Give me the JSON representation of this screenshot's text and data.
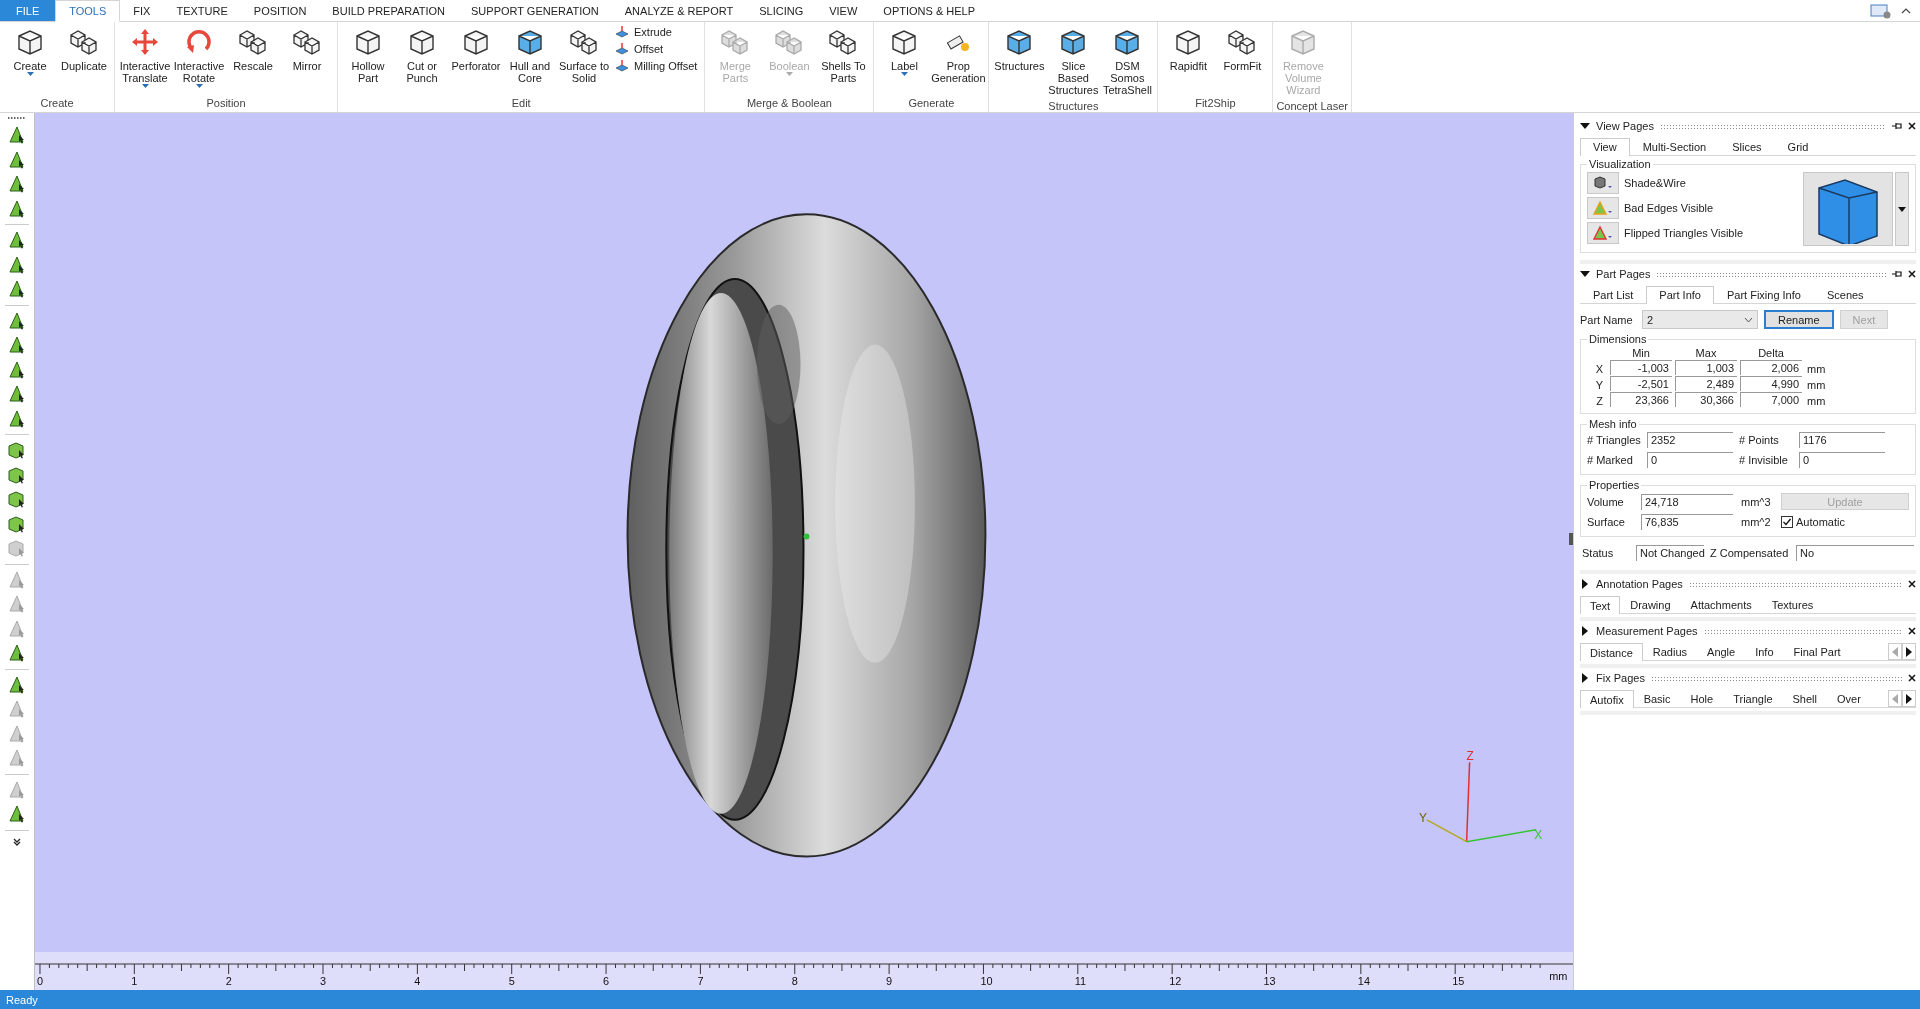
{
  "menu_tabs": [
    {
      "label": "FILE",
      "kind": "file",
      "selected": false
    },
    {
      "label": "TOOLS",
      "kind": "tab",
      "selected": true
    },
    {
      "label": "FIX",
      "kind": "tab",
      "selected": false
    },
    {
      "label": "TEXTURE",
      "kind": "tab",
      "selected": false
    },
    {
      "label": "POSITION",
      "kind": "tab",
      "selected": false
    },
    {
      "label": "BUILD PREPARATION",
      "kind": "tab",
      "selected": false
    },
    {
      "label": "SUPPORT GENERATION",
      "kind": "tab",
      "selected": false
    },
    {
      "label": "ANALYZE & REPORT",
      "kind": "tab",
      "selected": false
    },
    {
      "label": "SLICING",
      "kind": "tab",
      "selected": false
    },
    {
      "label": "VIEW",
      "kind": "tab",
      "selected": false
    },
    {
      "label": "OPTIONS & HELP",
      "kind": "tab",
      "selected": false
    }
  ],
  "ribbon_groups": [
    {
      "label": "Create",
      "buttons": [
        {
          "label": "Create",
          "kind": "cube",
          "dropdown": true,
          "disabled": false
        },
        {
          "label": "Duplicate",
          "kind": "cubes",
          "dropdown": false,
          "disabled": false
        }
      ]
    },
    {
      "label": "Position",
      "buttons": [
        {
          "label": "Interactive Translate",
          "kind": "move",
          "dropdown": true,
          "disabled": false
        },
        {
          "label": "Interactive Rotate",
          "kind": "rotate",
          "dropdown": true,
          "disabled": false
        },
        {
          "label": "Rescale",
          "kind": "cubes",
          "dropdown": false,
          "disabled": false
        },
        {
          "label": "Mirror",
          "kind": "cubes",
          "dropdown": false,
          "disabled": false
        }
      ]
    },
    {
      "label": "Edit",
      "buttons": [
        {
          "label": "Hollow Part",
          "kind": "cube",
          "dropdown": false,
          "disabled": false
        },
        {
          "label": "Cut or Punch",
          "kind": "cube",
          "dropdown": false,
          "disabled": false
        },
        {
          "label": "Perforator",
          "kind": "cube",
          "dropdown": false,
          "disabled": false
        },
        {
          "label": "Hull and Core",
          "kind": "bluecube",
          "dropdown": false,
          "disabled": false
        },
        {
          "label": "Surface to Solid",
          "kind": "cubes",
          "dropdown": false,
          "disabled": false
        },
        {
          "label": "Extrude",
          "kind": "small",
          "disabled": false
        },
        {
          "label": "Offset",
          "kind": "small",
          "disabled": false
        },
        {
          "label": "Milling Offset",
          "kind": "small",
          "disabled": false
        }
      ]
    },
    {
      "label": "Merge & Boolean",
      "buttons": [
        {
          "label": "Merge Parts",
          "kind": "cubes",
          "dropdown": false,
          "disabled": true
        },
        {
          "label": "Boolean",
          "kind": "cubes",
          "dropdown": true,
          "disabled": true
        },
        {
          "label": "Shells To Parts",
          "kind": "cubes",
          "dropdown": false,
          "disabled": false
        }
      ]
    },
    {
      "label": "Generate",
      "buttons": [
        {
          "label": "Label",
          "kind": "cube",
          "dropdown": true,
          "disabled": false
        },
        {
          "label": "Prop Generation",
          "kind": "prop",
          "dropdown": false,
          "disabled": false
        }
      ]
    },
    {
      "label": "Structures",
      "buttons": [
        {
          "label": "Structures",
          "kind": "bluecube",
          "dropdown": false,
          "disabled": false
        },
        {
          "label": "Slice Based Structures",
          "kind": "bluecube",
          "dropdown": false,
          "disabled": false
        },
        {
          "label": "DSM Somos TetraShell",
          "kind": "bluecube",
          "dropdown": false,
          "disabled": false
        }
      ]
    },
    {
      "label": "Fit2Ship",
      "buttons": [
        {
          "label": "Rapidfit",
          "kind": "cube",
          "dropdown": false,
          "disabled": false
        },
        {
          "label": "FormFit",
          "kind": "cubes",
          "dropdown": false,
          "disabled": false
        }
      ]
    },
    {
      "label": "Concept Laser",
      "buttons": [
        {
          "label": "Remove Volume Wizard",
          "kind": "cube",
          "dropdown": false,
          "disabled": true
        }
      ]
    }
  ],
  "left_toolbar": [
    [
      {
        "disabled": false
      },
      {
        "disabled": false
      },
      {
        "disabled": false
      },
      {
        "disabled": false
      }
    ],
    [
      {
        "disabled": false
      },
      {
        "disabled": false
      },
      {
        "disabled": false
      }
    ],
    [
      {
        "disabled": false
      },
      {
        "disabled": false
      },
      {
        "disabled": false
      },
      {
        "disabled": false
      },
      {
        "disabled": false
      }
    ],
    [
      {
        "disabled": false
      },
      {
        "disabled": false
      },
      {
        "disabled": false
      },
      {
        "disabled": false
      },
      {
        "disabled": true
      }
    ],
    [
      {
        "disabled": true
      },
      {
        "disabled": true
      },
      {
        "disabled": true
      },
      {
        "disabled": false
      }
    ],
    [
      {
        "disabled": false
      },
      {
        "disabled": true
      },
      {
        "disabled": true
      },
      {
        "disabled": true
      }
    ],
    [
      {
        "disabled": true
      },
      {
        "disabled": false
      }
    ]
  ],
  "viewport": {
    "axes": [
      "X",
      "Y",
      "Z"
    ]
  },
  "ruler": {
    "labels": [
      "0",
      "1",
      "2",
      "3",
      "4",
      "5",
      "6",
      "7",
      "8",
      "9",
      "10",
      "11",
      "12",
      "13",
      "14",
      "15"
    ],
    "unit": "mm"
  },
  "view_pages": {
    "title": "View Pages",
    "expanded": true,
    "tabs": [
      {
        "label": "View",
        "selected": true
      },
      {
        "label": "Multi-Section",
        "selected": false
      },
      {
        "label": "Slices",
        "selected": false
      },
      {
        "label": "Grid",
        "selected": false
      }
    ],
    "group": "Visualization",
    "options": [
      {
        "label": "Shade&Wire"
      },
      {
        "label": "Bad Edges Visible"
      },
      {
        "label": "Flipped Triangles Visible"
      }
    ]
  },
  "part_pages": {
    "title": "Part Pages",
    "expanded": true,
    "tabs": [
      {
        "label": "Part List",
        "selected": false
      },
      {
        "label": "Part Info",
        "selected": true
      },
      {
        "label": "Part Fixing Info",
        "selected": false
      },
      {
        "label": "Scenes",
        "selected": false
      }
    ],
    "part_name_label": "Part Name",
    "part_name": "2",
    "rename": "Rename",
    "next": {
      "label": "Next",
      "disabled": true
    },
    "dimensions": {
      "title": "Dimensions",
      "columns": [
        "Min",
        "Max",
        "Delta"
      ],
      "rows": [
        {
          "axis": "X",
          "values": [
            "-1,003",
            "1,003",
            "2,006"
          ],
          "unit": "mm"
        },
        {
          "axis": "Y",
          "values": [
            "-2,501",
            "2,489",
            "4,990"
          ],
          "unit": "mm"
        },
        {
          "axis": "Z",
          "values": [
            "23,366",
            "30,366",
            "7,000"
          ],
          "unit": "mm"
        }
      ]
    },
    "mesh_info": {
      "title": "Mesh info",
      "fields": [
        {
          "label": "# Triangles",
          "value": "2352"
        },
        {
          "label": "# Points",
          "value": "1176"
        },
        {
          "label": "# Marked",
          "value": "0"
        },
        {
          "label": "# Invisible",
          "value": "0"
        }
      ]
    },
    "properties": {
      "title": "Properties",
      "volume_label": "Volume",
      "volume": "24,718",
      "volume_unit": "mm^3",
      "surface_label": "Surface",
      "surface": "76,835",
      "surface_unit": "mm^2",
      "update": {
        "label": "Update",
        "disabled": true
      },
      "automatic": {
        "label": "Automatic",
        "checked": true
      }
    },
    "status_label": "Status",
    "status": "Not Changed",
    "z_comp_label": "Z Compensated",
    "z_comp": "No"
  },
  "collapsed_pages": [
    {
      "title": "Annotation Pages",
      "expanded": false,
      "scroll": false,
      "tabs": [
        {
          "label": "Text",
          "selected": true
        },
        {
          "label": "Drawing",
          "selected": false
        },
        {
          "label": "Attachments",
          "selected": false
        },
        {
          "label": "Textures",
          "selected": false
        }
      ]
    },
    {
      "title": "Measurement Pages",
      "expanded": false,
      "scroll": true,
      "tabs": [
        {
          "label": "Distance",
          "selected": true
        },
        {
          "label": "Radius",
          "selected": false
        },
        {
          "label": "Angle",
          "selected": false
        },
        {
          "label": "Info",
          "selected": false
        },
        {
          "label": "Final Part",
          "selected": false
        }
      ]
    },
    {
      "title": "Fix Pages",
      "expanded": false,
      "scroll": true,
      "tabs": [
        {
          "label": "Autofix",
          "selected": true
        },
        {
          "label": "Basic",
          "selected": false
        },
        {
          "label": "Hole",
          "selected": false
        },
        {
          "label": "Triangle",
          "selected": false
        },
        {
          "label": "Shell",
          "selected": false
        },
        {
          "label": "Over",
          "selected": false
        }
      ]
    }
  ],
  "status_bar": "Ready"
}
